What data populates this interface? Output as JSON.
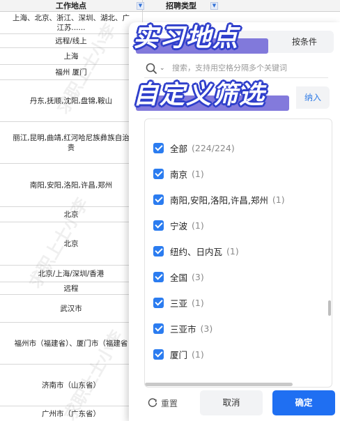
{
  "sheet": {
    "col_a_header": "工作地点",
    "col_b_header": "招聘类型",
    "filter_glyph": "▼",
    "rows": [
      {
        "text": "上海、北京、浙江、深圳、湖北、广\n江苏......",
        "h": 32
      },
      {
        "text": "远程/线上",
        "h": 20
      },
      {
        "text": "上海",
        "h": 24
      },
      {
        "text": "福州 厦门",
        "h": 22
      },
      {
        "text": "丹东,抚顺,沈阳,盘锦,鞍山",
        "h": 60
      },
      {
        "text": "丽江,昆明,曲靖,红河哈尼族彝族自治\n贵",
        "h": 60
      },
      {
        "text": "南阳,安阳,洛阳,许昌,郑州",
        "h": 62
      },
      {
        "text": "北京",
        "h": 22
      },
      {
        "text": "北京",
        "h": 62
      },
      {
        "text": "北京/上海/深圳/香港",
        "h": 24
      },
      {
        "text": "远程",
        "h": 18
      },
      {
        "text": "武汉市",
        "h": 40
      },
      {
        "text": "福州市（福建省）、厦门市（福建省",
        "h": 60
      },
      {
        "text": "济南市（山东省）",
        "h": 60
      },
      {
        "text": "广州市（广东省）",
        "h": 22
      }
    ]
  },
  "panel": {
    "tab_condition": "按条件",
    "search_placeholder": "搜索，支持用空格分隔多个关键词",
    "include_label": "纳入",
    "items": [
      {
        "label": "全部",
        "count": "(224/224)"
      },
      {
        "label": "南京",
        "count": "(1)"
      },
      {
        "label": "南阳,安阳,洛阳,许昌,郑州",
        "count": "(1)"
      },
      {
        "label": "宁波",
        "count": "(1)"
      },
      {
        "label": "纽约、日内瓦",
        "count": "(1)"
      },
      {
        "label": "全国",
        "count": "(3)"
      },
      {
        "label": "三亚",
        "count": "(1)"
      },
      {
        "label": "三亚市",
        "count": "(3)"
      },
      {
        "label": "厦门",
        "count": "(1)"
      }
    ],
    "reset_label": "重置",
    "cancel_label": "取消",
    "ok_label": "确定"
  },
  "overlay": {
    "title_line1": "实习地点",
    "title_line2": "自定义筛选",
    "watermark": "求职上士小李"
  },
  "colors": {
    "accent": "#1f6ff2",
    "checkbox": "#2b7cf0",
    "banner_outline": "#2f3fcb",
    "banner_fill": "#6d63d6"
  }
}
